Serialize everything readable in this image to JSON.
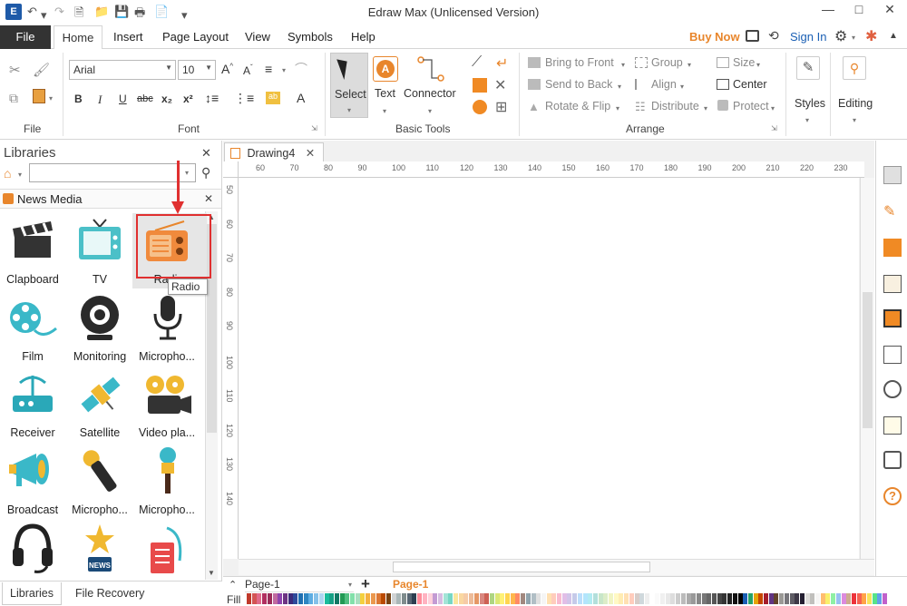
{
  "window": {
    "title": "Edraw Max (Unlicensed Version)",
    "minimize": "—",
    "maximize": "□",
    "close": "✕"
  },
  "tabs": {
    "file": "File",
    "items": [
      "Home",
      "Insert",
      "Page Layout",
      "View",
      "Symbols",
      "Help"
    ]
  },
  "header_right": {
    "buy_now": "Buy Now",
    "sign_in": "Sign In"
  },
  "ribbon": {
    "file_group": "File",
    "font_group": "Font",
    "font_name": "Arial",
    "font_size": "10",
    "basic_tools_group": "Basic Tools",
    "select": "Select",
    "text": "Text",
    "connector": "Connector",
    "arrange_group": "Arrange",
    "bring_to_front": "Bring to Front",
    "send_to_back": "Send to Back",
    "rotate_flip": "Rotate & Flip",
    "group": "Group",
    "align": "Align",
    "distribute": "Distribute",
    "size": "Size",
    "center": "Center",
    "protect": "Protect",
    "styles": "Styles",
    "editing": "Editing",
    "bold": "B",
    "italic": "I",
    "underline": "U",
    "strike": "abc",
    "subscript": "x₂",
    "superscript": "x²"
  },
  "libraries": {
    "title": "Libraries",
    "category": "News Media",
    "tooltip": "Radio",
    "items": [
      {
        "label": "Clapboard"
      },
      {
        "label": "TV"
      },
      {
        "label": "Radio"
      },
      {
        "label": "Film"
      },
      {
        "label": "Monitoring"
      },
      {
        "label": "Micropho..."
      },
      {
        "label": "Receiver"
      },
      {
        "label": "Satellite"
      },
      {
        "label": "Video pla..."
      },
      {
        "label": "Broadcast"
      },
      {
        "label": "Micropho..."
      },
      {
        "label": "Micropho..."
      },
      {
        "label": ""
      },
      {
        "label": ""
      },
      {
        "label": ""
      }
    ],
    "bottom_tabs": [
      "Libraries",
      "File Recovery"
    ]
  },
  "document": {
    "tab_name": "Drawing4",
    "hruler": [
      "60",
      "70",
      "80",
      "90",
      "100",
      "110",
      "120",
      "130",
      "140",
      "150",
      "160",
      "170",
      "180",
      "190",
      "200",
      "210",
      "220",
      "230"
    ],
    "vruler": [
      "50",
      "60",
      "70",
      "80",
      "90",
      "100",
      "110",
      "120",
      "130",
      "140"
    ]
  },
  "page_bar": {
    "page_select": "Page-1",
    "active_page": "Page-1",
    "fill_label": "Fill"
  },
  "colors": {
    "accent_orange": "#e8862c",
    "file_tab_bg": "#333333",
    "highlight_red": "#e03030",
    "link_blue": "#1a5fb4"
  }
}
